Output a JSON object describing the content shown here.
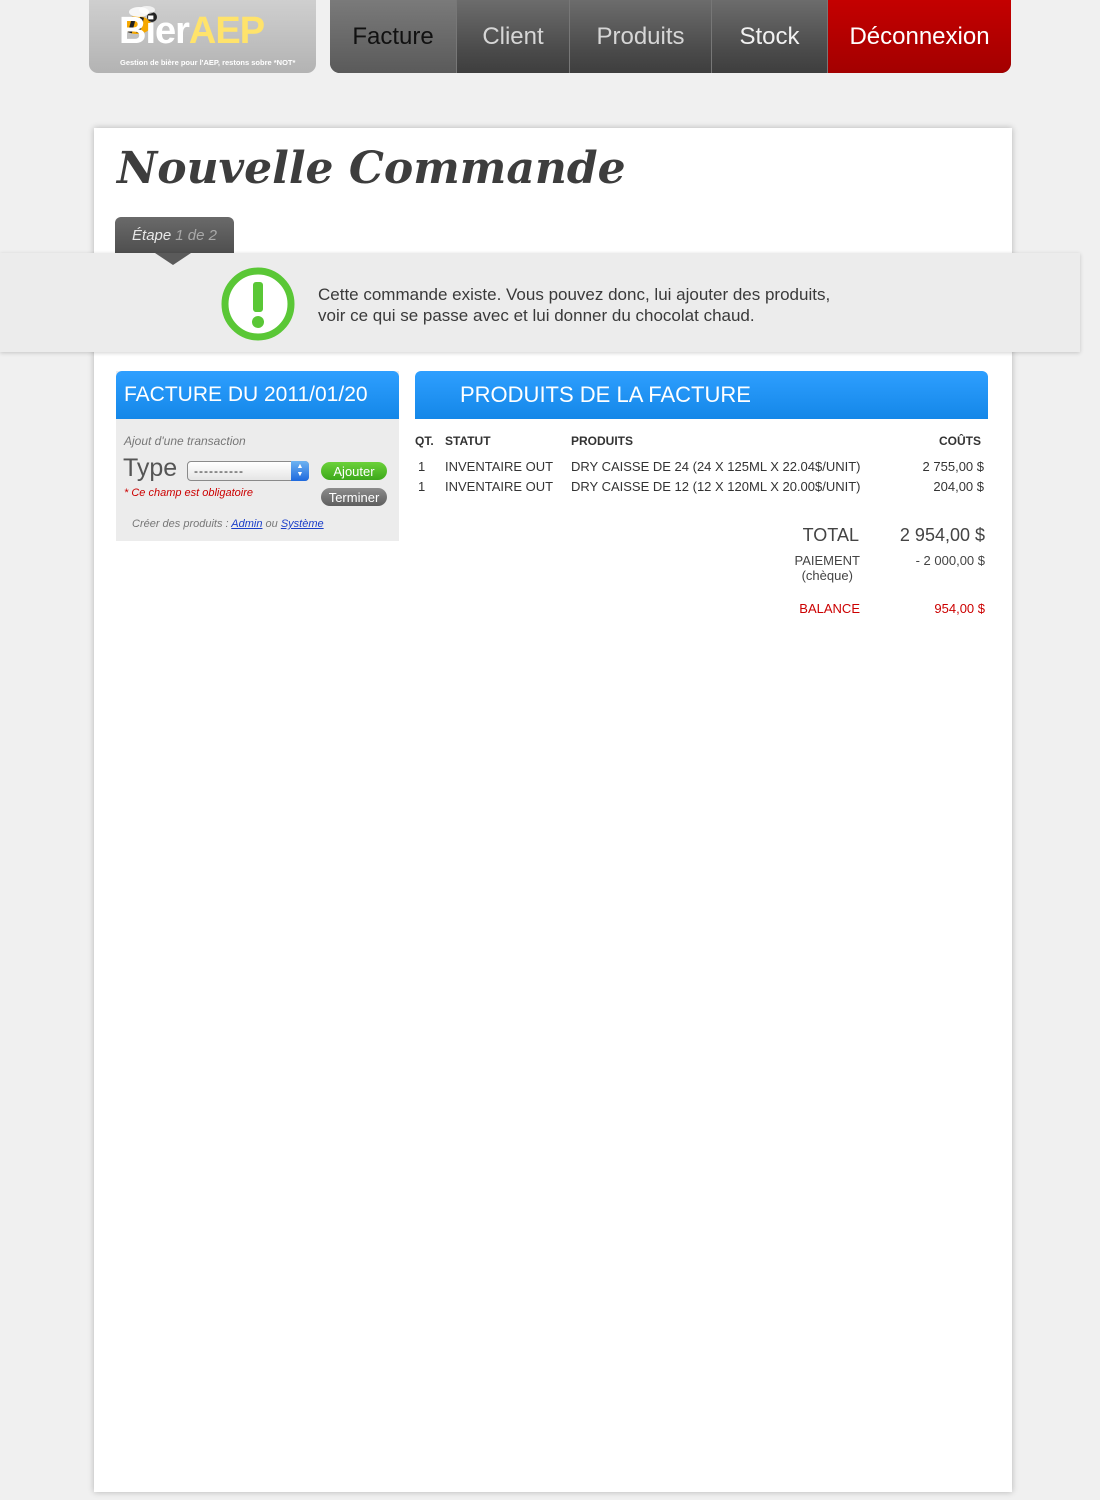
{
  "logo": {
    "brand_part1": "Bier",
    "brand_part2": "AEP",
    "tagline": "Gestion de bière pour l'AEP, restons sobre *NOT*"
  },
  "nav": {
    "items": [
      {
        "label": "Facture",
        "active": true
      },
      {
        "label": "Client"
      },
      {
        "label": "Produits"
      },
      {
        "label": "Stock"
      },
      {
        "label": "Déconnexion"
      }
    ]
  },
  "page": {
    "title": "Nouvelle Commande",
    "step_word": "Étape",
    "step_rest": "1 de 2"
  },
  "notice": {
    "icon": "exclamation-circle-icon",
    "line1": "Cette commande existe. Vous pouvez donc, lui ajouter des produits,",
    "line2": "voir ce qui se passe avec et lui donner du chocolat chaud."
  },
  "invoice_box": {
    "title": "FACTURE DU 2011/01/20",
    "subtitle": "Ajout d'une transaction",
    "type_label": "Type",
    "select_value": "----------",
    "required_note": "* Ce champ est obligatoire",
    "add_button": "Ajouter",
    "end_button": "Terminer",
    "create_prefix": "Créer des produits :",
    "create_admin": "Admin",
    "create_or": "ou",
    "create_system": "Système"
  },
  "products_box": {
    "title": "PRODUITS DE LA FACTURE",
    "columns": {
      "qty": "QT.",
      "status": "STATUT",
      "product": "PRODUITS",
      "cost": "COÛTS"
    },
    "rows": [
      {
        "qty": "1",
        "status": "INVENTAIRE OUT",
        "product": "DRY CAISSE DE 24 (24 X 125ML X 22.04$/UNIT)",
        "cost": "2 755,00 $"
      },
      {
        "qty": "1",
        "status": "INVENTAIRE OUT",
        "product": "DRY CAISSE DE 12 (12 X 120ML X 20.00$/UNIT)",
        "cost": "204,00 $"
      }
    ],
    "total_label": "TOTAL",
    "total_value": "2 954,00 $",
    "payment_label": "PAIEMENT",
    "payment_method": "(chèque)",
    "payment_value": "- 2 000,00 $",
    "balance_label": "BALANCE",
    "balance_value": "954,00 $"
  },
  "colors": {
    "accent_blue": "#1a8df0",
    "logout_red": "#b30000",
    "success_green": "#5ac736",
    "error_red": "#cc0000"
  }
}
